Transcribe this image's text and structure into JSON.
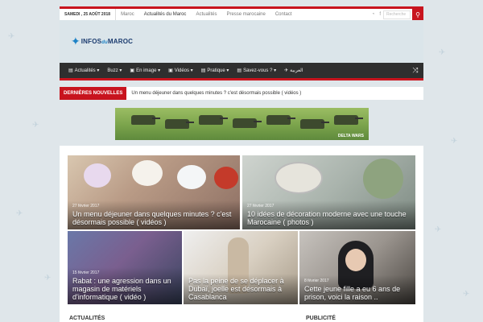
{
  "topbar": {
    "date": "SAMEDI , 25 AOÛT 2018",
    "links": [
      "Maroc",
      "Actualités du Maroc",
      "Actualités",
      "Presse marocaine",
      "Contact"
    ],
    "search_placeholder": "Recherche",
    "rss_icon": "rss-icon",
    "facebook_icon": "facebook-icon"
  },
  "logo": {
    "main": "INFOS",
    "du": "du",
    "end": "MAROC"
  },
  "mainnav": {
    "items": [
      {
        "icon": "▤",
        "label": "Actualités ▾"
      },
      {
        "icon": "",
        "label": "Buzz ▾"
      },
      {
        "icon": "▣",
        "label": "En image ▾"
      },
      {
        "icon": "▣",
        "label": "Vidéos ▾"
      },
      {
        "icon": "▤",
        "label": "Pratique ▾"
      },
      {
        "icon": "▤",
        "label": "Savez-vous ? ▾"
      },
      {
        "icon": "✈",
        "label": "العربية"
      }
    ],
    "shuffle_icon": "⤨"
  },
  "breaking": {
    "label": "DERNIÈRES NOUVELLES",
    "text": "Un menu déjeuner dans quelques minutes ? c'est désormais possible ( vidéos )"
  },
  "ad": {
    "text": "DELTA WARS"
  },
  "cards": [
    {
      "date": "27 février 2017",
      "title": "Un menu déjeuner dans quelques minutes ? c'est désormais possible ( vidéos )"
    },
    {
      "date": "27 février 2017",
      "title": "10 idées de décoration moderne avec une touche Marocaine ( photos )"
    },
    {
      "date": "15 février 2017",
      "title": "Rabat : une agression dans un magasin de matériels d'informatique ( vidéo )"
    },
    {
      "date": "",
      "title": "Pas la peine de se déplacer à Dubaï, joelle est désormais à Casablanca"
    },
    {
      "date": "8 février 2017",
      "title": "Cette jeune fille a eu 6 ans de prison, voici la raison .."
    }
  ],
  "sections": {
    "news": "ACTUALITÉS",
    "ads": "PUBLICITÉ"
  },
  "colors": {
    "accent": "#c8141e",
    "nav_bg": "#2f2f2f",
    "page_bg": "#dfe6ea"
  }
}
